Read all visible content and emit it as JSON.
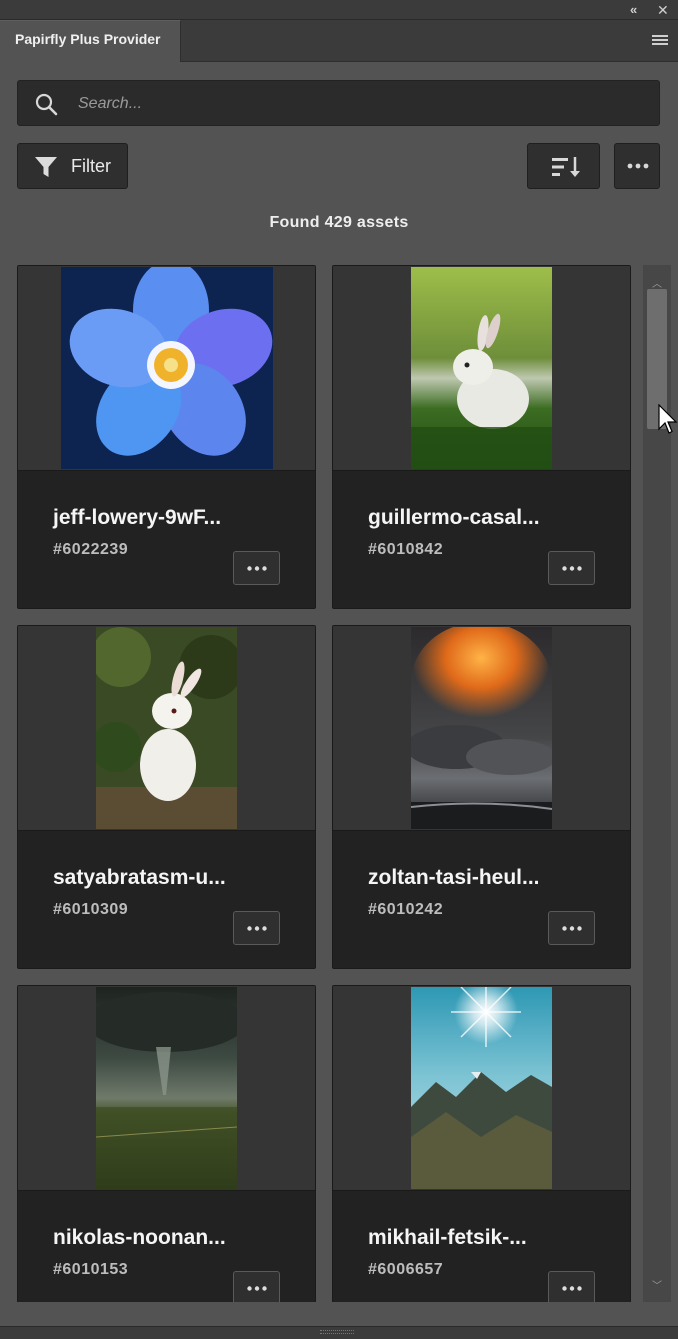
{
  "window": {
    "collapse_glyph": "«",
    "close_glyph": "✕"
  },
  "panel": {
    "tab_title": "Papirfly Plus Provider"
  },
  "search": {
    "placeholder": "Search...",
    "value": ""
  },
  "toolbar": {
    "filter_label": "Filter"
  },
  "results": {
    "found_text": "Found 429 assets"
  },
  "assets": [
    {
      "name": "jeff-lowery-9wF...",
      "id": "#6022239",
      "image": "blue-flower"
    },
    {
      "name": "guillermo-casal...",
      "id": "#6010842",
      "image": "white-rabbit-on-grass"
    },
    {
      "name": "satyabratasm-u...",
      "id": "#6010309",
      "image": "white-rabbit-forest"
    },
    {
      "name": "zoltan-tasi-heul...",
      "id": "#6010242",
      "image": "fiery-clouds-sea"
    },
    {
      "name": "nikolas-noonan...",
      "id": "#6010153",
      "image": "tornado-field"
    },
    {
      "name": "mikhail-fetsik-...",
      "id": "#6006657",
      "image": "sun-over-mountains"
    }
  ],
  "scrollbar": {
    "position_fraction": 0.0
  },
  "colors": {
    "panel_bg": "#535353",
    "card_bg": "#222222",
    "thumb_bg": "#353535",
    "header_bg": "#3b3b3b"
  }
}
